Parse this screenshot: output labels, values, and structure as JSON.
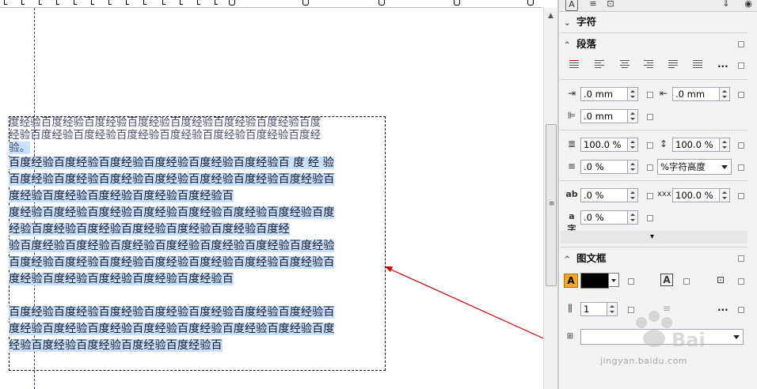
{
  "canvas": {
    "lines": [
      {
        "text": "度经验百度经验百度经验百度经验百度经验百度经验百度经验百度",
        "style": "top",
        "highlight": false
      },
      {
        "text": "经验百度经验百度经验百度经验百度经验百度经验百度经验百度经",
        "style": "top",
        "highlight": false
      },
      {
        "text": "验。",
        "style": "top",
        "highlight": true
      },
      {
        "text": "百度经验百度经验百度经验百度经验百度经验百度经验百 度 经 验",
        "style": "",
        "highlight": true
      },
      {
        "text": "百度经验百度经验百度经验百度经验百度经验百度经验百度经验百",
        "style": "",
        "highlight": true
      },
      {
        "text": "度经验百度经验百度经验百度经验百度经验百",
        "style": "",
        "highlight": true
      },
      {
        "text": "度经验百度经验百度经验百度经验百度经验百度经验百度经验百度",
        "style": "",
        "highlight": true
      },
      {
        "text": "经验百度经验百度经验百度经验百度经验百度经验百度经",
        "style": "",
        "highlight": true
      },
      {
        "text": "验百度经验百度经验百度经验百度经验百度经验百度经验百度经验",
        "style": "",
        "highlight": true
      },
      {
        "text": "百度经验百度经验百度经验百度经验百度经验百度经验百度经验百",
        "style": "",
        "highlight": true
      },
      {
        "text": "度经验百度经验百度经验百度经验百度经验百",
        "style": "",
        "highlight": true
      },
      {
        "text": " ",
        "style": "",
        "highlight": true
      },
      {
        "text": "百度经验百度经验百度经验百度经验百度经验百度经验百度经验百",
        "style": "",
        "highlight": true
      },
      {
        "text": "度经验百度经验百度经验百度经验百度经验百度经验百度经验百度",
        "style": "",
        "highlight": true
      },
      {
        "text": "经验百度经验百度经验百度经验百度经验百",
        "style": "",
        "highlight": true
      }
    ],
    "highlight_color": "#c7e0fb",
    "arrow_color": "#d00000"
  },
  "docker": {
    "char_section": "字符",
    "para_section": "段落",
    "frame_section": "图文框",
    "icons": {
      "tab_char": "A-boxed-icon",
      "tab_para": "paragraph-icon",
      "tab_frame": "frame-icon",
      "pin": "pin-icon",
      "eye": "eye-icon"
    },
    "fields": {
      "left_indent": ".0 mm",
      "right_indent": ".0 mm",
      "first_line_indent": ".0 mm",
      "line_spacing": "100.0 %",
      "para_spacing_before": "100.0 %",
      "para_spacing_after": ".0 %",
      "spacing_unit": "%字符高度",
      "char_spacing": ".0 %",
      "word_spacing": "100.0 %",
      "language_spacing": ".0 %",
      "columns": "1"
    },
    "more": "...",
    "expand": "▾"
  },
  "watermark": {
    "text": "jingyan.baidu.com"
  }
}
